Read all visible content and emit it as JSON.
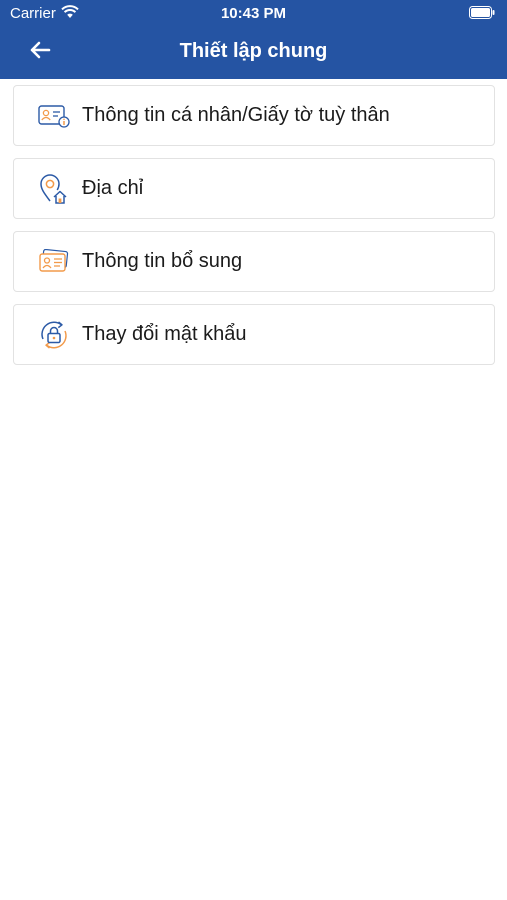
{
  "status_bar": {
    "carrier": "Carrier",
    "time": "10:43 PM",
    "wifi_icon": "wifi-icon",
    "battery_icon": "battery-icon"
  },
  "header": {
    "title": "Thiết lập chung",
    "back_icon": "arrow-left-icon",
    "background_color": "#2554a3"
  },
  "menu": {
    "items": [
      {
        "label": "Thông tin cá nhân/Giấy tờ tuỳ thân",
        "icon": "id-card-icon"
      },
      {
        "label": "Địa chỉ",
        "icon": "location-home-icon"
      },
      {
        "label": "Thông tin bổ sung",
        "icon": "profile-cards-icon"
      },
      {
        "label": "Thay đổi mật khẩu",
        "icon": "lock-refresh-icon"
      }
    ]
  },
  "colors": {
    "icon_blue": "#2c5aa6",
    "icon_orange": "#f29a4a"
  }
}
